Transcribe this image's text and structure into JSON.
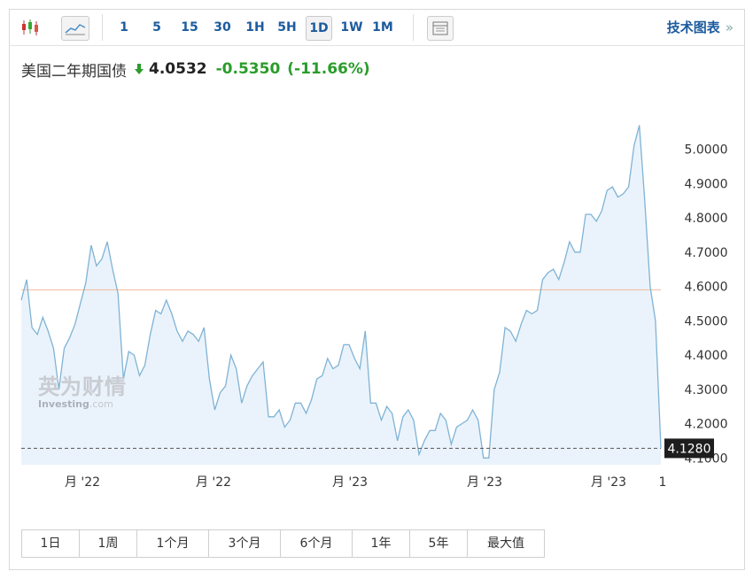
{
  "toolbar": {
    "intervals": [
      "1",
      "5",
      "15",
      "30",
      "1H",
      "5H",
      "1D",
      "1W",
      "1M"
    ],
    "active_interval": "1D",
    "tech_chart_label": "技术图表",
    "tech_chart_chevron": "»",
    "icons": [
      "candlestick-chart-icon",
      "area-chart-icon",
      "table-view-icon",
      "chevron-right-icon"
    ]
  },
  "quote": {
    "name": "美国二年期国债",
    "last": "4.0532",
    "change": "-0.5350",
    "change_pct": "(-11.66%)",
    "direction": "down",
    "change_color": "#2a9d2a"
  },
  "watermark": {
    "name_cn": "英为财情",
    "name_en": "Investing",
    "domain": ".com"
  },
  "time_ranges": [
    "1日",
    "1周",
    "1个月",
    "3个月",
    "6个月",
    "1年",
    "5年",
    "最大值"
  ],
  "colors": {
    "line": "#7fb3d5",
    "fill": "#eaf3fb",
    "reference_line": "#f4b79a",
    "current_price_bg": "#1e1e1e",
    "link": "#1d5b9e"
  },
  "chart_data": {
    "type": "area",
    "title": "",
    "xlabel": "",
    "ylabel": "",
    "ylim": [
      4.08,
      5.12
    ],
    "y_ticks": [
      "5.0000",
      "4.9000",
      "4.8000",
      "4.7000",
      "4.6000",
      "4.5000",
      "4.4000",
      "4.3000",
      "4.2000",
      "4.1000"
    ],
    "x_ticks": [
      "月 '22",
      "月 '22",
      "月 '23",
      "月 '23",
      "月 '23",
      "1"
    ],
    "reference_level": 4.59,
    "current_price": 4.128,
    "current_price_label": "4.1280",
    "grid": false,
    "series": [
      {
        "values": [
          4.56,
          4.62,
          4.48,
          4.46,
          4.51,
          4.47,
          4.42,
          4.3,
          4.42,
          4.45,
          4.49,
          4.55,
          4.61,
          4.72,
          4.66,
          4.68,
          4.73,
          4.65,
          4.58,
          4.33,
          4.41,
          4.4,
          4.34,
          4.37,
          4.46,
          4.53,
          4.52,
          4.56,
          4.52,
          4.47,
          4.44,
          4.47,
          4.46,
          4.44,
          4.48,
          4.33,
          4.24,
          4.29,
          4.31,
          4.4,
          4.36,
          4.26,
          4.31,
          4.34,
          4.36,
          4.38,
          4.22,
          4.22,
          4.24,
          4.19,
          4.21,
          4.26,
          4.26,
          4.23,
          4.27,
          4.33,
          4.34,
          4.39,
          4.36,
          4.37,
          4.43,
          4.43,
          4.39,
          4.36,
          4.47,
          4.26,
          4.26,
          4.21,
          4.25,
          4.23,
          4.15,
          4.22,
          4.24,
          4.21,
          4.11,
          4.15,
          4.18,
          4.18,
          4.23,
          4.21,
          4.14,
          4.19,
          4.2,
          4.21,
          4.24,
          4.21,
          4.1,
          4.1,
          4.3,
          4.35,
          4.48,
          4.47,
          4.44,
          4.49,
          4.53,
          4.52,
          4.53,
          4.62,
          4.64,
          4.65,
          4.62,
          4.67,
          4.73,
          4.7,
          4.7,
          4.81,
          4.81,
          4.79,
          4.82,
          4.88,
          4.89,
          4.86,
          4.87,
          4.89,
          5.01,
          5.07,
          4.85,
          4.6,
          4.5,
          4.13
        ]
      }
    ]
  }
}
